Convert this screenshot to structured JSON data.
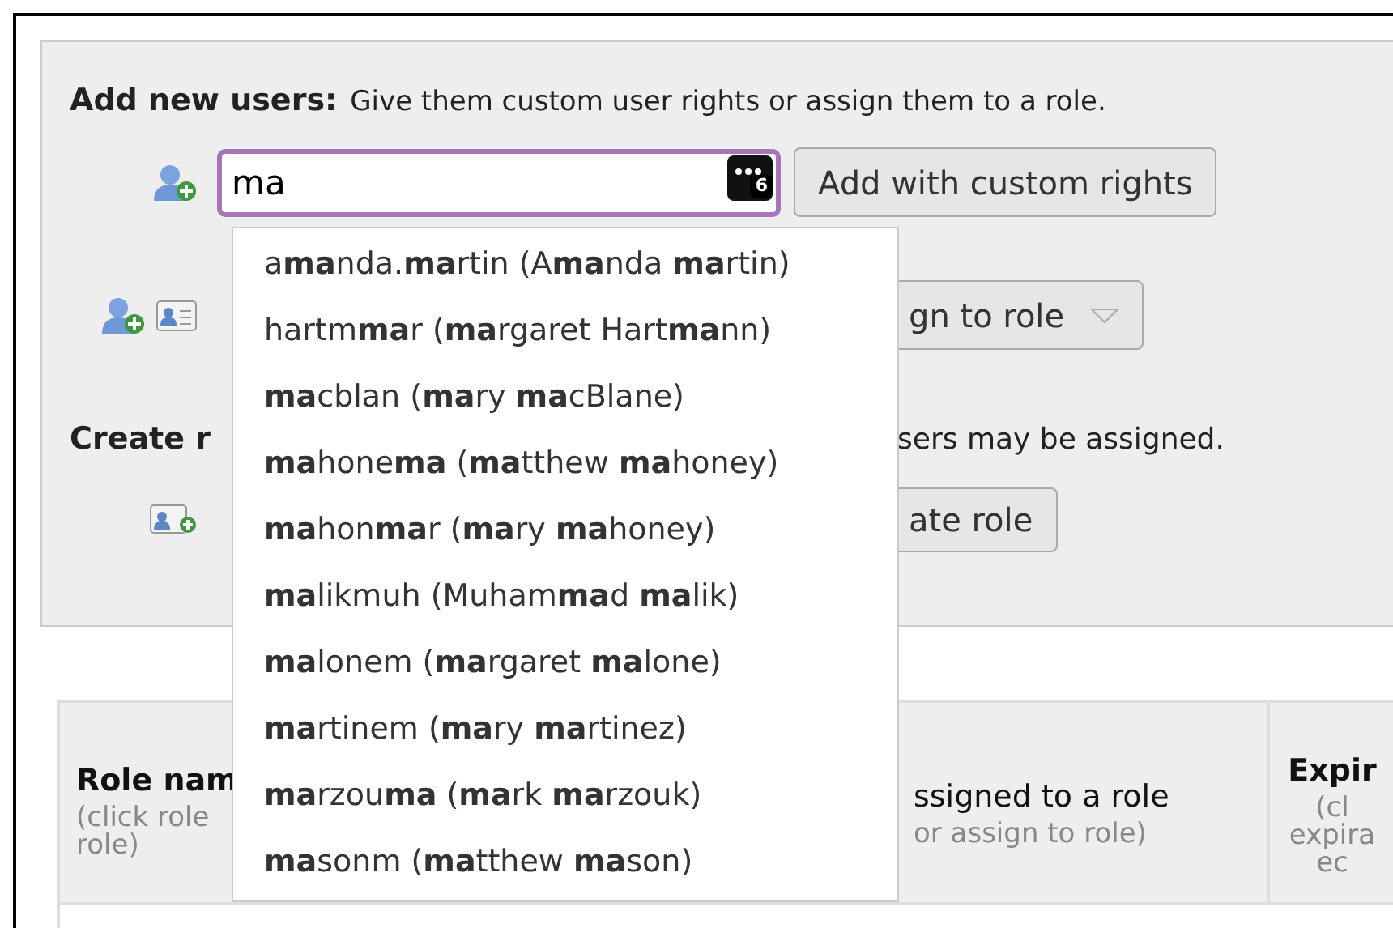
{
  "heading": {
    "title": "Add new users:",
    "description": "Give them custom user rights or assign them to a role."
  },
  "user_field": {
    "value": "ma",
    "badge": "6"
  },
  "custom_rights_button": "Add with custom rights",
  "assign_role_button": "gn to role",
  "create_role": {
    "title": "Create r",
    "description": "sers may be assigned."
  },
  "create_role_button": "ate role",
  "table": {
    "columns": [
      {
        "title": "Role nam",
        "hint_lines": [
          "(click role",
          "role)"
        ]
      },
      {
        "title": "ssigned to a role",
        "hint_lines": [
          "or assign to role)"
        ]
      },
      {
        "title": "Expir",
        "hint_lines": [
          "(cl",
          "expira",
          "ec"
        ]
      }
    ]
  },
  "suggestions": [
    "a**ma**nda.**ma**rtin (A**ma**nda **ma**rtin)",
    "hartm**ma**r (**ma**rgaret Hart**ma**nn)",
    "**ma**cblan (**ma**ry **ma**cBlane)",
    "**ma**hone**ma** (**ma**tthew **ma**honey)",
    "**ma**hon**ma**r (**ma**ry **ma**honey)",
    "**ma**likmuh (Muham**ma**d **ma**lik)",
    "**ma**lonem (**ma**rgaret **ma**lone)",
    "**ma**rtinem (**ma**ry **ma**rtinez)",
    "**ma**rzou**ma** (**ma**rk **ma**rzouk)",
    "**ma**sonm (**ma**tthew **ma**son)"
  ]
}
